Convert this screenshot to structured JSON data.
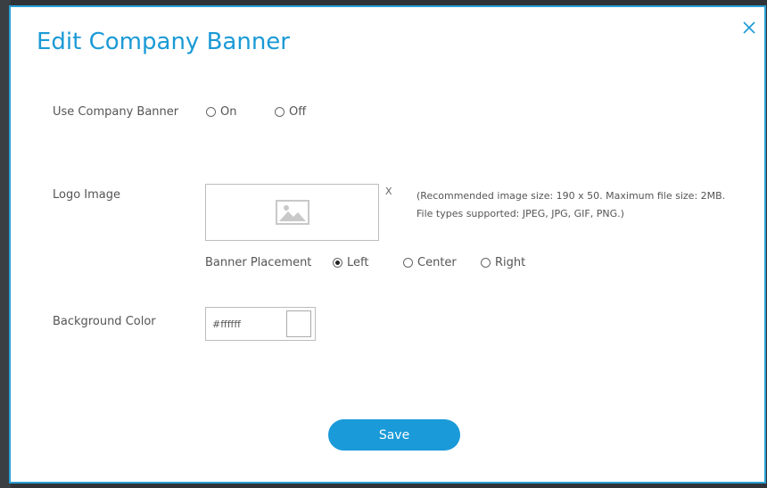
{
  "dialog": {
    "title": "Edit Company Banner",
    "close_icon": "close-icon",
    "accent_color": "#1b9ad6"
  },
  "use_banner": {
    "label": "Use Company Banner",
    "options": [
      {
        "label": "On",
        "checked": false
      },
      {
        "label": "Off",
        "checked": false
      }
    ]
  },
  "logo": {
    "label": "Logo Image",
    "placeholder_icon": "image-icon",
    "remove_label": "X",
    "hint": "(Recommended image size: 190 x 50. Maximum file size: 2MB. File types supported: JPEG, JPG, GIF, PNG.)"
  },
  "placement": {
    "label": "Banner Placement",
    "options": [
      {
        "label": "Left",
        "checked": true
      },
      {
        "label": "Center",
        "checked": false
      },
      {
        "label": "Right",
        "checked": false
      }
    ]
  },
  "background": {
    "label": "Background Color",
    "value": "#ffffff",
    "swatch_color": "#ffffff"
  },
  "actions": {
    "save_label": "Save"
  }
}
